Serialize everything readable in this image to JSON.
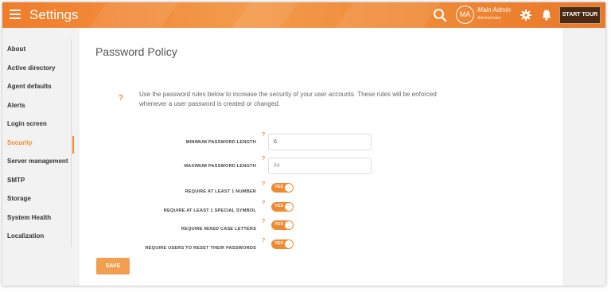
{
  "header": {
    "title": "Settings",
    "avatar_initials": "MA",
    "user_name": "Main Admin",
    "user_role": "Administrator",
    "start_tour_label": "START TOUR",
    "accent": "#f08a30"
  },
  "sidebar": {
    "items": [
      {
        "label": "About"
      },
      {
        "label": "Active directory"
      },
      {
        "label": "Agent defaults"
      },
      {
        "label": "Alerts"
      },
      {
        "label": "Login screen"
      },
      {
        "label": "Security",
        "active": true
      },
      {
        "label": "Server management"
      },
      {
        "label": "SMTP"
      },
      {
        "label": "Storage"
      },
      {
        "label": "System Health"
      },
      {
        "label": "Localization"
      }
    ]
  },
  "main": {
    "title": "Password Policy",
    "help_mark": "?",
    "intro": "Use the password rules below to increase the security of your user accounts. These rules will be enforced whenever a user password is created or changed.",
    "fields": {
      "min_length": {
        "label": "MINIMUM PASSWORD LENGTH",
        "value": "6"
      },
      "max_length": {
        "label": "MAXIMUM PASSWORD LENGTH",
        "value": "64"
      }
    },
    "toggles": {
      "number": {
        "label": "REQUIRE AT LEAST 1 NUMBER",
        "state": "YES"
      },
      "symbol": {
        "label": "REQUIRE AT LEAST 1 SPECIAL SYMBOL",
        "state": "YES"
      },
      "mixed_case": {
        "label": "REQUIRE MIXED CASE LETTERS",
        "state": "YES"
      },
      "reset": {
        "label": "REQUIRE USERS TO RESET THEIR PASSWORDS",
        "state": "YES"
      }
    },
    "save_label": "SAVE"
  }
}
